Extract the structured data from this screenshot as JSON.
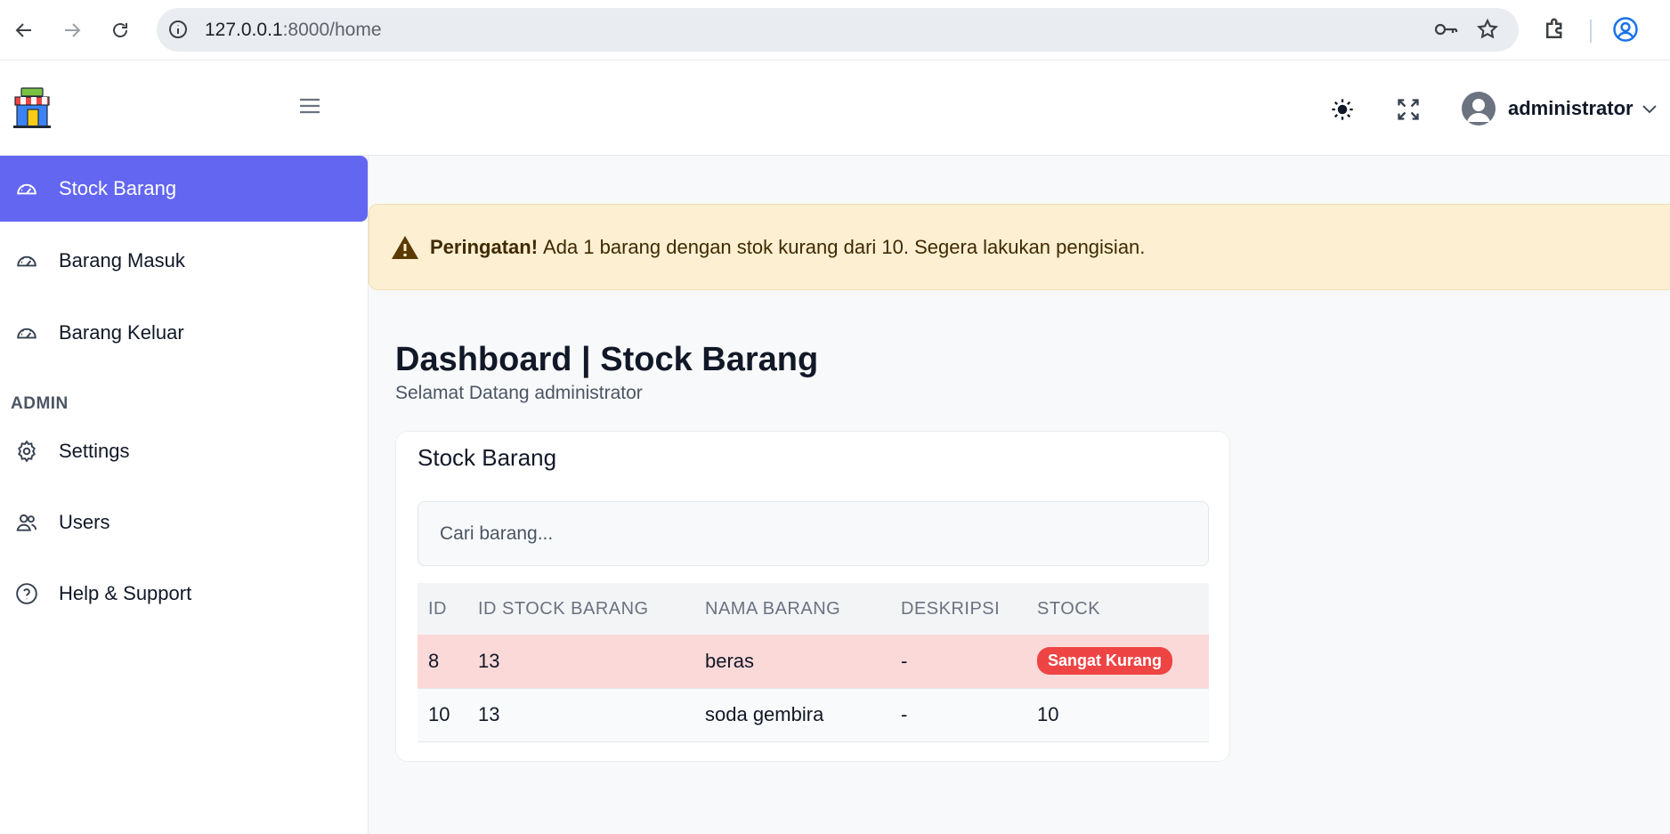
{
  "browser": {
    "url_host": "127.0.0.1",
    "url_path": ":8000/home"
  },
  "header": {
    "user_name": "administrator"
  },
  "sidebar": {
    "items": [
      {
        "label": "Stock Barang",
        "icon": "dashboard-gauge-icon",
        "active": true
      },
      {
        "label": "Barang Masuk",
        "icon": "dashboard-gauge-icon",
        "active": false
      },
      {
        "label": "Barang Keluar",
        "icon": "dashboard-gauge-icon",
        "active": false
      }
    ],
    "section_label": "ADMIN",
    "admin_items": [
      {
        "label": "Settings",
        "icon": "gear-icon"
      },
      {
        "label": "Users",
        "icon": "users-icon"
      },
      {
        "label": "Help & Support",
        "icon": "help-icon"
      }
    ]
  },
  "alert": {
    "title": "Peringatan!",
    "message": "Ada 1 barang dengan stok kurang dari 10. Segera lakukan pengisian."
  },
  "page": {
    "title": "Dashboard | Stock Barang",
    "subtitle": "Selamat Datang administrator"
  },
  "card": {
    "title": "Stock Barang",
    "search_placeholder": "Cari barang...",
    "columns": [
      "ID",
      "ID STOCK BARANG",
      "NAMA BARANG",
      "DESKRIPSI",
      "STOCK"
    ],
    "rows": [
      {
        "id": "8",
        "id_stock": "13",
        "nama": "beras",
        "deskripsi": "-",
        "stock": "Sangat Kurang",
        "status": "danger"
      },
      {
        "id": "10",
        "id_stock": "13",
        "nama": "soda gembira",
        "deskripsi": "-",
        "stock": "10",
        "status": "normal"
      }
    ]
  },
  "colors": {
    "accent": "#6366f1",
    "alert_bg": "#fcefd2",
    "danger_row": "#fcd9d9",
    "badge_danger": "#ef4444"
  }
}
